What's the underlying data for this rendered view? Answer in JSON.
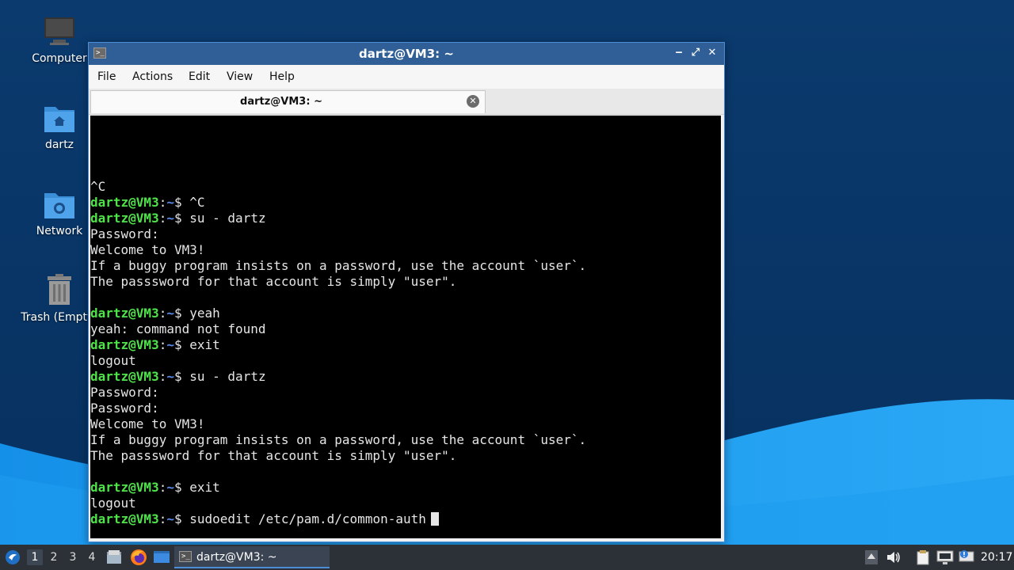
{
  "desktop": {
    "icons": [
      {
        "label": "Computer"
      },
      {
        "label": "dartz"
      },
      {
        "label": "Network"
      },
      {
        "label": "Trash (Empty)"
      }
    ]
  },
  "window": {
    "title": "dartz@VM3: ~",
    "controls": {
      "minimize": "‒",
      "maximize": "⤢",
      "close": "✕"
    },
    "menu": [
      "File",
      "Actions",
      "Edit",
      "View",
      "Help"
    ],
    "tab": {
      "label": "dartz@VM3: ~",
      "close": "✕"
    }
  },
  "terminal": {
    "prompt": {
      "user_host": "dartz@VM3",
      "sep": ":",
      "path": "~",
      "symbol": "$"
    },
    "lines": [
      {
        "type": "out",
        "text": "^C"
      },
      {
        "type": "cmd",
        "text": " ^C"
      },
      {
        "type": "cmd",
        "text": " su - dartz"
      },
      {
        "type": "out",
        "text": "Password:"
      },
      {
        "type": "out",
        "text": "Welcome to VM3!"
      },
      {
        "type": "out",
        "text": "If a buggy program insists on a password, use the account `user`."
      },
      {
        "type": "out",
        "text": "The passsword for that account is simply \"user\"."
      },
      {
        "type": "out",
        "text": ""
      },
      {
        "type": "cmd",
        "text": " yeah"
      },
      {
        "type": "out",
        "text": "yeah: command not found"
      },
      {
        "type": "cmd",
        "text": " exit"
      },
      {
        "type": "out",
        "text": "logout"
      },
      {
        "type": "cmd",
        "text": " su - dartz"
      },
      {
        "type": "out",
        "text": "Password:"
      },
      {
        "type": "out",
        "text": "Password:"
      },
      {
        "type": "out",
        "text": "Welcome to VM3!"
      },
      {
        "type": "out",
        "text": "If a buggy program insists on a password, use the account `user`."
      },
      {
        "type": "out",
        "text": "The passsword for that account is simply \"user\"."
      },
      {
        "type": "out",
        "text": ""
      },
      {
        "type": "cmd",
        "text": " exit"
      },
      {
        "type": "out",
        "text": "logout"
      },
      {
        "type": "cmd",
        "text": " sudoedit /etc/pam.d/common-auth",
        "cursor": true
      }
    ]
  },
  "taskbar": {
    "workspaces": [
      "1",
      "2",
      "3",
      "4"
    ],
    "active_workspace": "1",
    "task": {
      "label": "dartz@VM3: ~"
    },
    "clock": "20:17"
  },
  "colors": {
    "prompt_user": "#4fe34a",
    "prompt_path": "#5a8cf0",
    "titlebar": "#2f5f96",
    "taskbar": "#2c3138"
  }
}
